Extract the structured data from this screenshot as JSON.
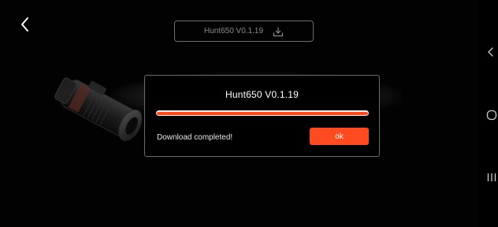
{
  "header": {
    "firmware_label": "Hunt650  V0.1.19",
    "icons": {
      "back": "chevron-left-icon",
      "download": "download-icon"
    }
  },
  "dialog": {
    "title": "Hunt650  V0.1.19",
    "progress": 1.0,
    "status": "Download completed!",
    "ok_label": "ok"
  },
  "system_nav": {
    "icons": [
      "back-arrow-icon",
      "home-circle-icon",
      "recent-apps-icon"
    ]
  },
  "colors": {
    "accent": "#ff4b1f",
    "background": "#000000",
    "progress_track": "#ededed"
  }
}
